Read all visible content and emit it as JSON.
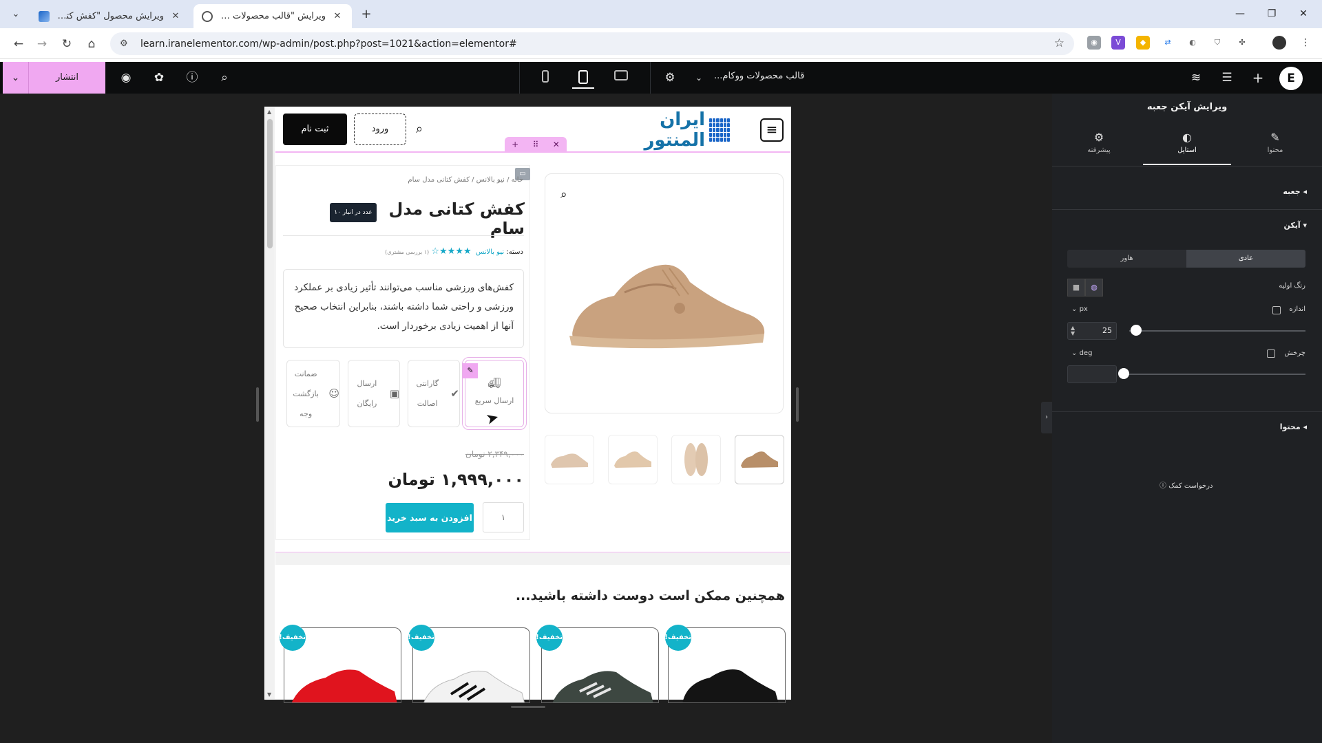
{
  "browser": {
    "tabs": [
      {
        "title": "ویرایش محصول \"کفش کتانی مدل",
        "active": false
      },
      {
        "title": "ویرایش \"قالب محصولات ووکامر",
        "active": true
      }
    ],
    "url": "learn.iranelementor.com/wp-admin/post.php?post=1021&action=elementor#"
  },
  "editor": {
    "publish_label": "انتشار",
    "document_title": "قالب محصولات ووکام...",
    "accent": "#f0a8f1"
  },
  "site": {
    "logo_text": "ایران المنتور",
    "login_label": "ورود",
    "register_label": "ثبت نام"
  },
  "product": {
    "breadcrumb": "خانه / نیو بالانس / کفش کتانی مدل سام",
    "title": "کفش کتانی مدل سام",
    "stock": "۱۰ عدد در انبار",
    "category_label": "دسته:",
    "category": "نیو بالانس",
    "rating": 4.5,
    "reviews": "(۱ بررسی مشتری)",
    "description": "کفش‌های ورزشی مناسب می‌توانند تأثیر زیادی بر عملکرد ورزشی و راحتی شما داشته باشند، بنابراین انتخاب صحیح آنها از اهمیت زیادی برخوردار است.",
    "features": [
      {
        "label": "ارسال سریع",
        "icon": "truck-icon"
      },
      {
        "label": "گارانتی اصالت",
        "icon": "check-icon"
      },
      {
        "label": "ارسال رایگان",
        "icon": "box-icon"
      },
      {
        "label": "ضمانت بازگشت وجه",
        "icon": "smile-icon"
      }
    ],
    "old_price": "۲,۳۴۹,۰۰۰ تومان",
    "price": "۱,۹۹۹,۰۰۰ تومان",
    "quantity": "۱",
    "add_to_cart": "افزودن به سبد خرید"
  },
  "related": {
    "title": "همچنین ممکن است دوست داشته باشید...",
    "badge": "تخفیف!",
    "items": [
      "red",
      "white",
      "gray",
      "black"
    ]
  },
  "panel": {
    "title": "ویرایش آیکن جعبه",
    "tabs": {
      "content": "محتوا",
      "style": "استایل",
      "advanced": "پیشرفته"
    },
    "section_box": "جعبه",
    "section_icon": "آیکن",
    "state_normal": "عادی",
    "state_hover": "هاور",
    "primary_color": "رنگ اولیه",
    "size_label": "اندازه",
    "size_unit": "px",
    "size_value": "25",
    "rotate_label": "چرخش",
    "rotate_unit": "deg",
    "section_content": "محتوا",
    "help": "درخواست کمک"
  }
}
